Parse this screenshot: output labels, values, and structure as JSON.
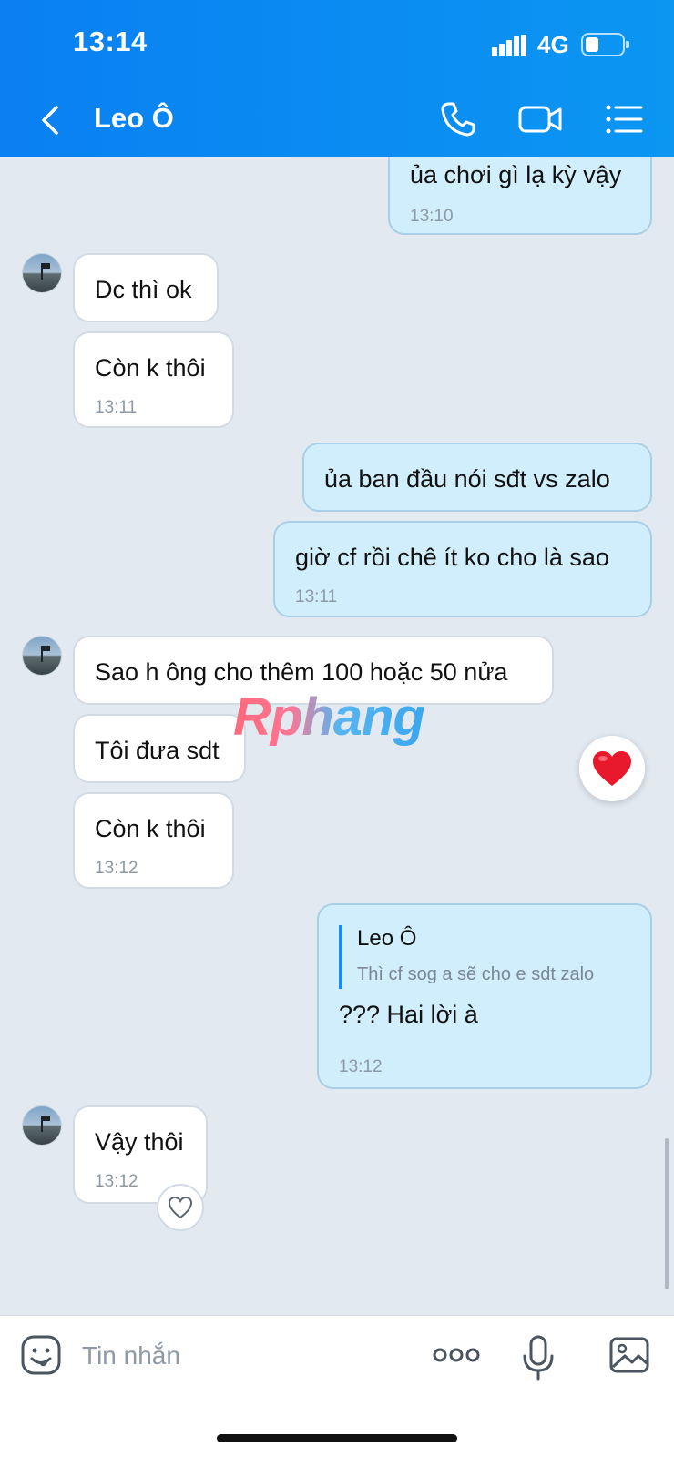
{
  "status_bar": {
    "time": "13:14",
    "network": "4G",
    "battery_percent": 30
  },
  "header": {
    "title": "Leo Ô"
  },
  "messages": {
    "m1": {
      "text": "ủa chơi gì lạ kỳ vậy",
      "time": "13:10"
    },
    "m2": {
      "text": "Dc thì ok"
    },
    "m3": {
      "text": "Còn k thôi",
      "time": "13:11"
    },
    "m4": {
      "text": "ủa ban đầu nói sđt vs zalo"
    },
    "m5": {
      "text": "giờ cf rồi chê ít ko cho là sao",
      "time": "13:11"
    },
    "m6": {
      "text": "Sao h ông cho thêm 100 hoặc 50 nửa"
    },
    "m7": {
      "text": "Tôi đưa sdt"
    },
    "m8": {
      "text": "Còn k thôi",
      "time": "13:12"
    },
    "m9": {
      "quote_name": "Leo Ô",
      "quote_text": "Thì cf sog a sẽ cho e sdt zalo",
      "text": "??? Hai lời à",
      "time": "13:12"
    },
    "m10": {
      "text": "Vậy thôi",
      "time": "13:12"
    }
  },
  "watermark": "Rphang",
  "input": {
    "placeholder": "Tin nhắn"
  },
  "colors": {
    "header_blue": "#0a80f2",
    "outgoing_bubble": "#d1eefc",
    "incoming_bubble": "#ffffff",
    "chat_bg": "#e2e9f1",
    "heart_red": "#e8192c"
  },
  "icons": [
    "back-arrow-icon",
    "phone-icon",
    "video-call-icon",
    "menu-list-icon",
    "heart-reaction-icon",
    "like-heart-icon",
    "sticker-icon",
    "more-icon",
    "microphone-icon",
    "image-icon"
  ]
}
